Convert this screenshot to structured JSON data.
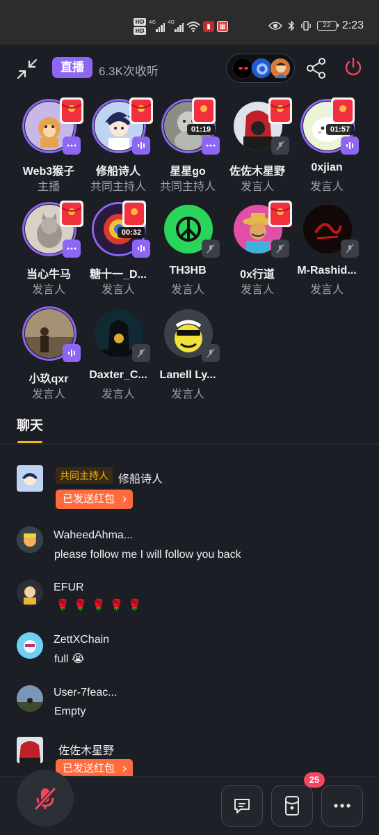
{
  "status_bar": {
    "network_labels": [
      "HD",
      "HD"
    ],
    "signal_label_1": "4G",
    "signal_label_2": "4G",
    "battery": "22",
    "time": "2:23"
  },
  "header": {
    "live_label": "直播",
    "listeners": "6.3K次收听"
  },
  "speakers": [
    {
      "name": "Web3猴子",
      "role": "主播",
      "mic": "dots",
      "has_redpacket": true,
      "timer": ""
    },
    {
      "name": "修船诗人",
      "role": "共同主持人",
      "mic": "on",
      "has_redpacket": true,
      "timer": ""
    },
    {
      "name": "星星go",
      "role": "共同主持人",
      "mic": "dots",
      "has_redpacket": true,
      "timer": "01:19"
    },
    {
      "name": "佐佐木星野",
      "role": "发言人",
      "mic": "off",
      "has_redpacket": true,
      "timer": ""
    },
    {
      "name": "0xjian",
      "role": "发言人",
      "mic": "on",
      "has_redpacket": true,
      "timer": "01:57"
    },
    {
      "name": "当心牛马",
      "role": "发言人",
      "mic": "dots",
      "has_redpacket": true,
      "timer": ""
    },
    {
      "name": "糖十一_D...",
      "role": "发言人",
      "mic": "on",
      "has_redpacket": true,
      "timer": "00:32"
    },
    {
      "name": "TH3HB",
      "role": "发言人",
      "mic": "off",
      "has_redpacket": false,
      "timer": ""
    },
    {
      "name": "0x行道",
      "role": "发言人",
      "mic": "off",
      "has_redpacket": true,
      "timer": ""
    },
    {
      "name": "M-Rashid...",
      "role": "发言人",
      "mic": "off",
      "has_redpacket": false,
      "timer": ""
    },
    {
      "name": "小玖qxr",
      "role": "发言人",
      "mic": "on",
      "has_redpacket": false,
      "timer": ""
    },
    {
      "name": "Daxter_C...",
      "role": "发言人",
      "mic": "off",
      "has_redpacket": false,
      "timer": ""
    },
    {
      "name": "Lanell Ly...",
      "role": "发言人",
      "mic": "off",
      "has_redpacket": false,
      "timer": ""
    }
  ],
  "chat": {
    "tab_label": "聊天",
    "messages": [
      {
        "badge": "共同主持人",
        "name": "修船诗人",
        "action": "已发送红包"
      },
      {
        "name": "WaheedAhma...",
        "text": "please follow me I will follow you back"
      },
      {
        "name": "EFUR",
        "text": "🌹🌹🌹🌹🌹"
      },
      {
        "name": "ZettXChain",
        "text": "full 😭"
      },
      {
        "name": "User-7feac...",
        "text": "Empty"
      },
      {
        "name": "佐佐木星野",
        "action": "已发送红包"
      }
    ]
  },
  "bottom_bar": {
    "badge_count": "25"
  },
  "colors": {
    "accent": "#8e66f4",
    "brand_yellow": "#f0b90b",
    "redpacket": "#ff6b3d",
    "badge_red": "#f6465d",
    "background": "#1b1e24"
  }
}
